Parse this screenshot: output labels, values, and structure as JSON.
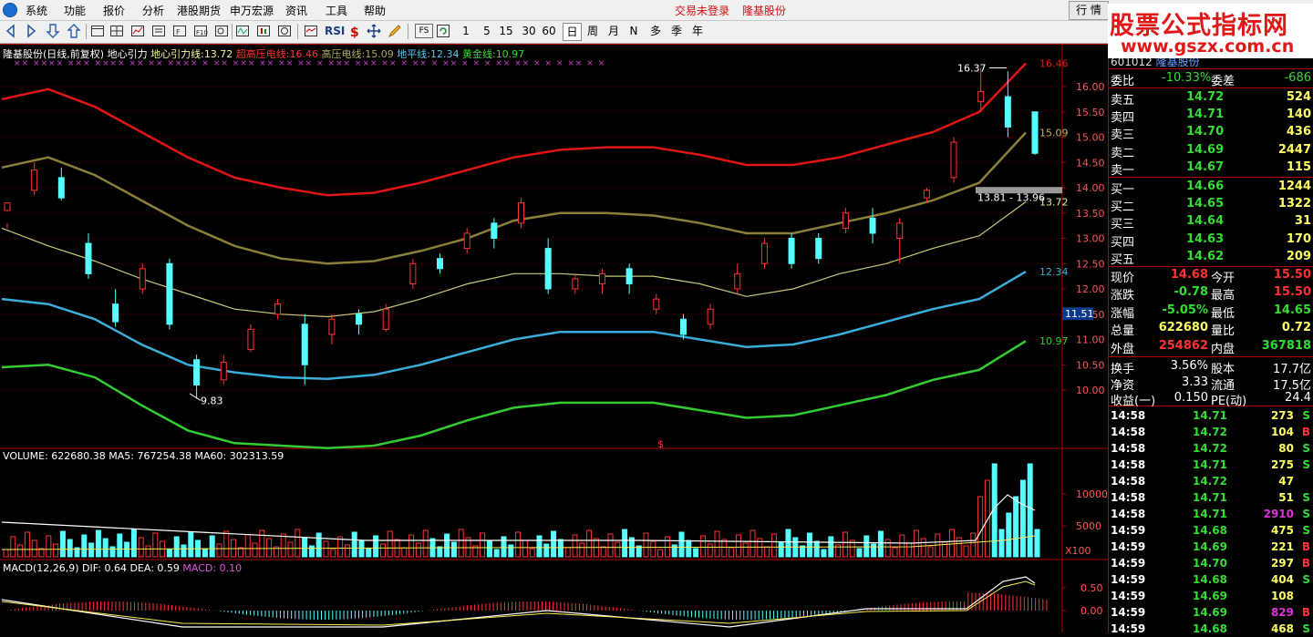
{
  "menu": {
    "items": [
      "系统",
      "功能",
      "报价",
      "分析",
      "港股期货",
      "申万宏源",
      "资讯",
      "工具",
      "帮助"
    ],
    "status_trade": "交易未登录",
    "status_stock": "隆基股份",
    "quote_button": "行 情"
  },
  "toolbar": {
    "periods": [
      "1",
      "5",
      "15",
      "30",
      "60",
      "日",
      "周",
      "月",
      "N",
      "多",
      "季",
      "年"
    ],
    "active_period": "日",
    "rsi_label": "RSI",
    "fs_label": "FS",
    "icon_names": [
      "back-icon",
      "forward-icon",
      "down-arrow-icon",
      "up-arrow-icon",
      "window-icon",
      "grid-icon",
      "trend-icon",
      "list-icon",
      "fund-icon",
      "f10-icon",
      "magnifier-icon",
      "rsi-icon",
      "money-icon",
      "move-icon",
      "pen-icon",
      "fs-icon",
      "refresh-icon"
    ]
  },
  "watermark": {
    "title": "股票公式指标网",
    "url": "www.gszx.com.cn"
  },
  "colors": {
    "up": "#ff3333",
    "down": "#54ffff",
    "super_high_line": "#e01515",
    "high_line": "#8a7f3a",
    "gravity_line": "#c8c87a",
    "ground_line": "#3aaed8",
    "gold_line": "#33cc33"
  },
  "price_chart": {
    "legend": {
      "name": "隆基股份(日线,前复权)",
      "indicator": "地心引力",
      "gravity_label": "地心引力线:",
      "gravity_value": "13.72",
      "super_label": "超高压电线:",
      "super_value": "16.46",
      "high_label": "高压电线:",
      "high_value": "15.09",
      "ground_label": "地平线:",
      "ground_value": "12.34",
      "gold_label": "黄金线:",
      "gold_value": "10.97"
    },
    "y_ticks": [
      "16.00",
      "15.50",
      "15.00",
      "14.50",
      "14.00",
      "13.50",
      "13.00",
      "12.50",
      "12.00",
      "11.50",
      "11.00",
      "10.50",
      "10.00"
    ],
    "right_labels": {
      "super": "16.46",
      "high": "15.09",
      "gravity": "13.72",
      "ground": "12.34",
      "gold": "10.97"
    },
    "cursor_price": "11.51",
    "annotation_high": "16.37",
    "annotation_low": "9.83",
    "range_label": "13.81 - 13.96",
    "dollar_mark": "$"
  },
  "volume_chart": {
    "legend": {
      "label": "VOLUME:",
      "volume": "622680.38",
      "ma5_label": "MA5:",
      "ma5": "767254.38",
      "ma60_label": "MA60:",
      "ma60": "302313.59"
    },
    "y_ticks": [
      "10000",
      "5000"
    ],
    "unit": "X100"
  },
  "macd_chart": {
    "legend": {
      "label": "MACD(12,26,9)",
      "dif_label": "DIF:",
      "dif": "0.64",
      "dea_label": "DEA:",
      "dea": "0.59",
      "macd_label": "MACD:",
      "macd": "0.10"
    },
    "y_ticks": [
      "0.50",
      "0.00"
    ]
  },
  "quote_panel": {
    "code": "601012",
    "name": "隆基股份",
    "wei_bi_label": "委比",
    "wei_bi": "-10.33%",
    "wei_cha_label": "委差",
    "wei_cha": "-686",
    "asks": [
      {
        "label": "卖五",
        "price": "14.72",
        "vol": "524"
      },
      {
        "label": "卖四",
        "price": "14.71",
        "vol": "140"
      },
      {
        "label": "卖三",
        "price": "14.70",
        "vol": "436"
      },
      {
        "label": "卖二",
        "price": "14.69",
        "vol": "2447"
      },
      {
        "label": "卖一",
        "price": "14.67",
        "vol": "115"
      }
    ],
    "bids": [
      {
        "label": "买一",
        "price": "14.66",
        "vol": "1244"
      },
      {
        "label": "买二",
        "price": "14.65",
        "vol": "1322"
      },
      {
        "label": "买三",
        "price": "14.64",
        "vol": "31"
      },
      {
        "label": "买四",
        "price": "14.63",
        "vol": "170"
      },
      {
        "label": "买五",
        "price": "14.62",
        "vol": "209"
      }
    ],
    "stats": [
      {
        "l1": "现价",
        "v1": "14.68",
        "c1": "#ff3333",
        "l2": "今开",
        "v2": "15.50",
        "c2": "#ff3333"
      },
      {
        "l1": "涨跌",
        "v1": "-0.78",
        "c1": "#33dd33",
        "l2": "最高",
        "v2": "15.50",
        "c2": "#ff3333"
      },
      {
        "l1": "涨幅",
        "v1": "-5.05%",
        "c1": "#33dd33",
        "l2": "最低",
        "v2": "14.65",
        "c2": "#33dd33"
      },
      {
        "l1": "总量",
        "v1": "622680",
        "c1": "#ffff66",
        "l2": "量比",
        "v2": "0.72",
        "c2": "#ffff66"
      },
      {
        "l1": "外盘",
        "v1": "254862",
        "c1": "#ff3333",
        "l2": "内盘",
        "v2": "367818",
        "c2": "#33dd33"
      }
    ],
    "stats2": [
      {
        "l1": "换手",
        "v1": "3.56%",
        "l2": "股本",
        "v2": "17.7亿"
      },
      {
        "l1": "净资",
        "v1": "3.33",
        "l2": "流通",
        "v2": "17.5亿"
      },
      {
        "l1": "收益(一)",
        "v1": "0.150",
        "l2": "PE(动)",
        "v2": "24.4"
      }
    ],
    "ticks": [
      {
        "time": "14:58",
        "price": "14.71",
        "vol": "273",
        "flag": "S",
        "vc": "#ffff66",
        "fc": "#33dd33"
      },
      {
        "time": "14:58",
        "price": "14.72",
        "vol": "104",
        "flag": "B",
        "vc": "#ffff66",
        "fc": "#ff3333"
      },
      {
        "time": "14:58",
        "price": "14.72",
        "vol": "80",
        "flag": "S",
        "vc": "#ffff66",
        "fc": "#33dd33"
      },
      {
        "time": "14:58",
        "price": "14.71",
        "vol": "275",
        "flag": "S",
        "vc": "#ffff66",
        "fc": "#33dd33"
      },
      {
        "time": "14:58",
        "price": "14.72",
        "vol": "47",
        "flag": "",
        "vc": "#ffff66",
        "fc": "#33dd33"
      },
      {
        "time": "14:58",
        "price": "14.71",
        "vol": "51",
        "flag": "S",
        "vc": "#ffff66",
        "fc": "#33dd33"
      },
      {
        "time": "14:58",
        "price": "14.71",
        "vol": "2910",
        "flag": "S",
        "vc": "#dd33dd",
        "fc": "#33dd33"
      },
      {
        "time": "14:59",
        "price": "14.68",
        "vol": "475",
        "flag": "S",
        "vc": "#ffff66",
        "fc": "#33dd33"
      },
      {
        "time": "14:59",
        "price": "14.69",
        "vol": "221",
        "flag": "B",
        "vc": "#ffff66",
        "fc": "#ff3333"
      },
      {
        "time": "14:59",
        "price": "14.70",
        "vol": "297",
        "flag": "B",
        "vc": "#ffff66",
        "fc": "#ff3333"
      },
      {
        "time": "14:59",
        "price": "14.68",
        "vol": "404",
        "flag": "S",
        "vc": "#ffff66",
        "fc": "#33dd33"
      },
      {
        "time": "14:59",
        "price": "14.69",
        "vol": "108",
        "flag": "",
        "vc": "#ffff66",
        "fc": "#33dd33"
      },
      {
        "time": "14:59",
        "price": "14.69",
        "vol": "829",
        "flag": "B",
        "vc": "#dd33dd",
        "fc": "#ff3333"
      },
      {
        "time": "14:59",
        "price": "14.68",
        "vol": "468",
        "flag": "S",
        "vc": "#ffff66",
        "fc": "#33dd33"
      }
    ]
  },
  "chart_data": {
    "type": "line",
    "title": "隆基股份(日线,前复权)",
    "series": [
      {
        "name": "超高压电线",
        "values": [
          15.75,
          15.95,
          15.6,
          15.1,
          14.6,
          14.2,
          14.0,
          13.85,
          13.9,
          14.1,
          14.35,
          14.6,
          14.75,
          14.8,
          14.8,
          14.65,
          14.45,
          14.45,
          14.6,
          14.85,
          15.1,
          15.5,
          16.46
        ]
      },
      {
        "name": "高压电线",
        "values": [
          14.4,
          14.6,
          14.25,
          13.75,
          13.25,
          12.85,
          12.6,
          12.5,
          12.55,
          12.75,
          13.0,
          13.35,
          13.5,
          13.5,
          13.45,
          13.3,
          13.1,
          13.1,
          13.3,
          13.5,
          13.75,
          14.1,
          15.09
        ]
      },
      {
        "name": "地心引力线",
        "values": [
          13.2,
          12.85,
          12.55,
          12.2,
          11.9,
          11.6,
          11.5,
          11.45,
          11.55,
          11.8,
          12.1,
          12.3,
          12.3,
          12.25,
          12.25,
          12.1,
          11.85,
          12.0,
          12.3,
          12.5,
          12.8,
          13.05,
          13.72
        ]
      },
      {
        "name": "地平线",
        "values": [
          11.8,
          11.7,
          11.4,
          10.9,
          10.5,
          10.35,
          10.25,
          10.22,
          10.3,
          10.5,
          10.75,
          11.0,
          11.15,
          11.15,
          11.15,
          11.0,
          10.85,
          10.9,
          11.1,
          11.35,
          11.6,
          11.8,
          12.34
        ]
      },
      {
        "name": "黄金线",
        "values": [
          10.45,
          10.5,
          10.25,
          9.7,
          9.2,
          8.95,
          8.9,
          8.85,
          8.9,
          9.1,
          9.4,
          9.65,
          9.75,
          9.75,
          9.75,
          9.6,
          9.45,
          9.5,
          9.7,
          9.9,
          10.2,
          10.4,
          10.97
        ]
      }
    ],
    "candles": [
      [
        13.55,
        13.7,
        13.3,
        13.2
      ],
      [
        13.95,
        14.35,
        13.85,
        14.5
      ],
      [
        14.2,
        13.8,
        13.75,
        14.4
      ],
      [
        12.9,
        12.3,
        12.2,
        13.1
      ],
      [
        11.7,
        11.35,
        11.25,
        12.0
      ],
      [
        12.0,
        12.4,
        11.9,
        12.5
      ],
      [
        12.5,
        11.3,
        11.2,
        12.6
      ],
      [
        10.6,
        10.1,
        9.83,
        10.7
      ],
      [
        10.2,
        10.55,
        10.1,
        10.7
      ],
      [
        10.8,
        11.2,
        10.75,
        11.3
      ],
      [
        11.5,
        11.7,
        11.4,
        11.8
      ],
      [
        11.3,
        10.5,
        10.1,
        11.5
      ],
      [
        11.1,
        11.4,
        10.9,
        11.5
      ],
      [
        11.5,
        11.3,
        11.1,
        11.6
      ],
      [
        11.2,
        11.6,
        11.15,
        11.7
      ],
      [
        12.1,
        12.5,
        12.0,
        12.6
      ],
      [
        12.6,
        12.4,
        12.3,
        12.7
      ],
      [
        12.8,
        13.1,
        12.7,
        13.2
      ],
      [
        13.3,
        13.0,
        12.8,
        13.4
      ],
      [
        13.3,
        13.7,
        13.2,
        13.8
      ],
      [
        12.8,
        12.0,
        11.9,
        13.0
      ],
      [
        12.0,
        12.2,
        11.9,
        12.3
      ],
      [
        12.1,
        12.3,
        11.9,
        12.4
      ],
      [
        12.4,
        12.1,
        11.9,
        12.5
      ],
      [
        11.6,
        11.8,
        11.5,
        11.9
      ],
      [
        11.4,
        11.1,
        11.0,
        11.5
      ],
      [
        11.3,
        11.6,
        11.2,
        11.7
      ],
      [
        12.0,
        12.3,
        11.9,
        12.5
      ],
      [
        12.5,
        12.9,
        12.4,
        13.0
      ],
      [
        13.0,
        12.5,
        12.4,
        13.1
      ],
      [
        13.0,
        12.6,
        12.5,
        13.1
      ],
      [
        13.2,
        13.5,
        13.1,
        13.6
      ],
      [
        13.4,
        13.1,
        12.9,
        13.6
      ],
      [
        13.0,
        13.3,
        12.5,
        13.4
      ],
      [
        13.8,
        13.95,
        13.7,
        14.0
      ],
      [
        14.2,
        14.9,
        14.1,
        15.0
      ],
      [
        15.7,
        15.9,
        15.5,
        16.37
      ],
      [
        15.8,
        15.2,
        15.0,
        16.3
      ],
      [
        15.5,
        14.68,
        14.65,
        15.5
      ]
    ]
  }
}
